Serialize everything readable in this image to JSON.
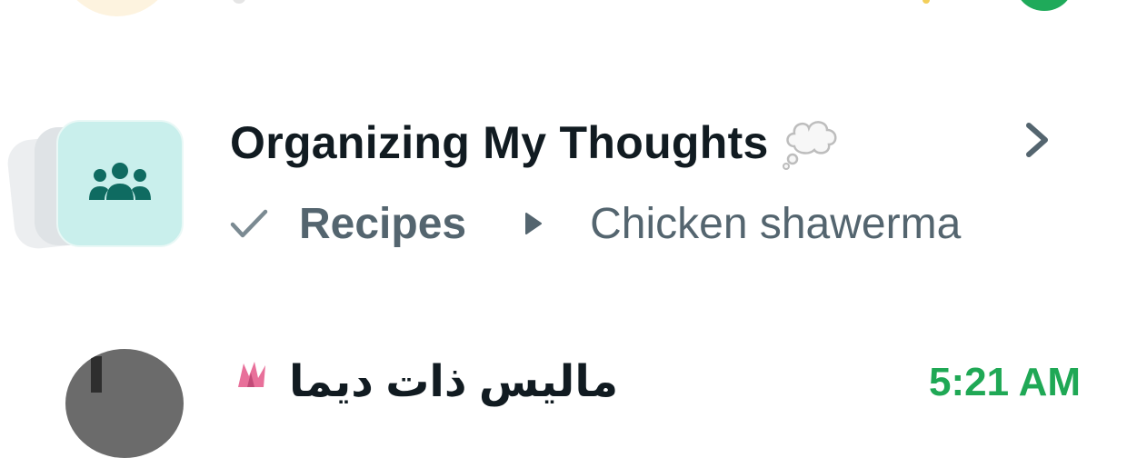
{
  "top_row": {
    "avatar_color": "#fdf3df",
    "unread_badge_color": "#1faa5a"
  },
  "community": {
    "title": "Organizing My Thoughts",
    "title_icon": "thought-bubble-icon",
    "community_icon": "community-people-icon",
    "community_icon_bg": "#c9efec",
    "community_icon_fg": "#0f6b61",
    "chevron": "chevron-right-icon",
    "read_status_icon": "check-icon",
    "group_name": "Recipes",
    "separator_icon": "play-icon",
    "last_message": "Chicken shawerma"
  },
  "bottom_row": {
    "title": "ماليس ذات ديما",
    "title_emoji": "flower-icon",
    "time": "5:21 AM",
    "time_color": "#1fa855"
  },
  "colors": {
    "primary_text": "#111b21",
    "secondary_text": "#54656f",
    "background": "#ffffff"
  }
}
